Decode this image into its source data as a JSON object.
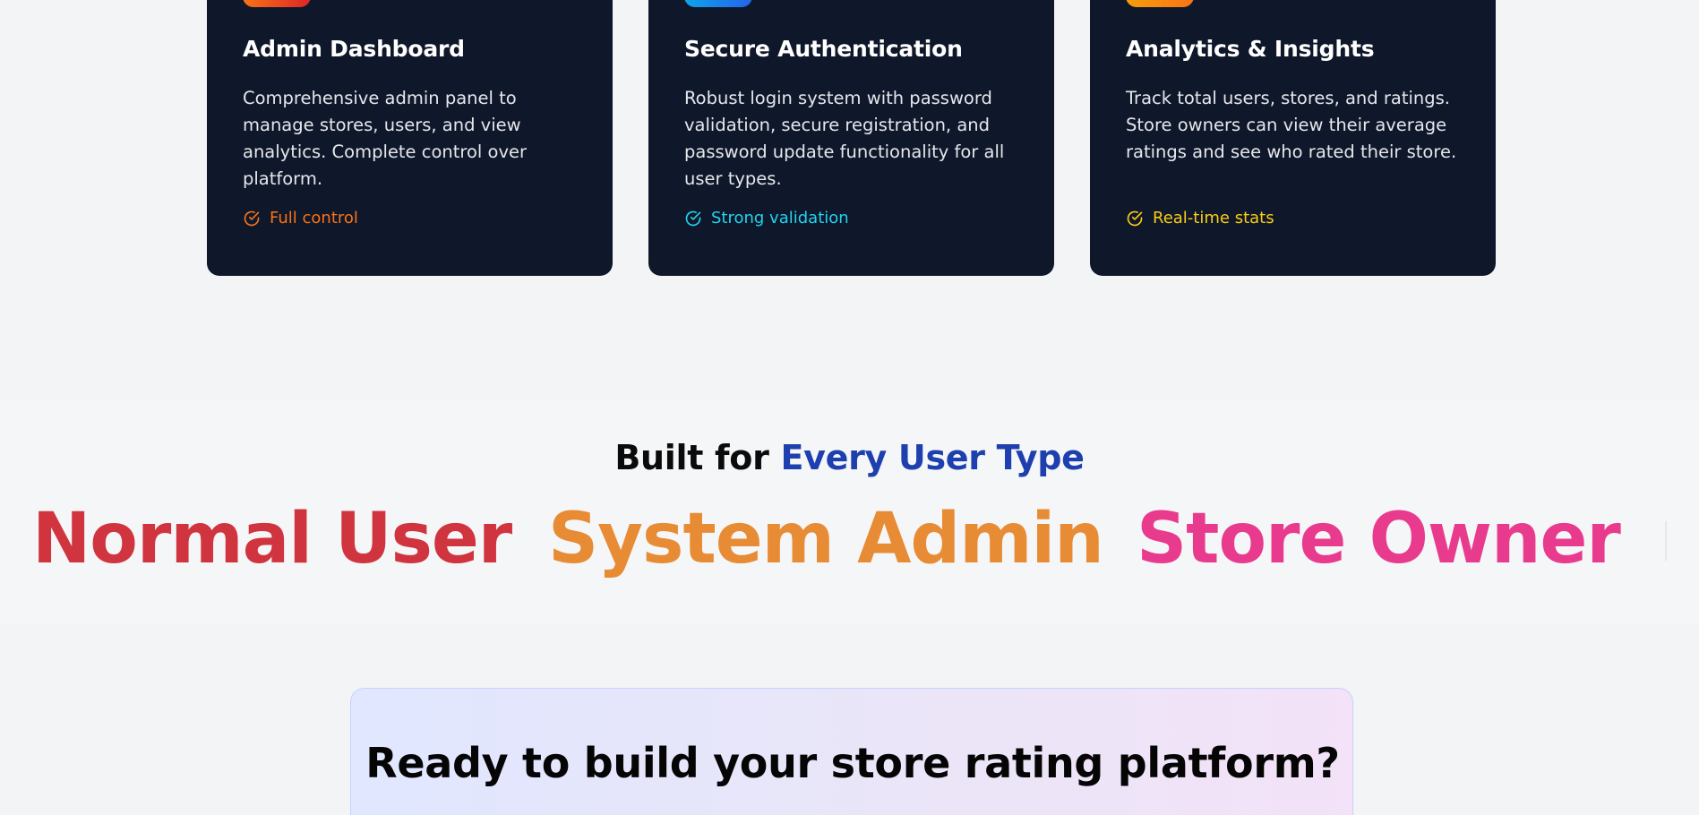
{
  "features": {
    "cards": [
      {
        "title": "Admin Dashboard",
        "description": "Comprehensive admin panel to manage stores, users, and view analytics. Complete control over platform.",
        "tag": "Full control",
        "accent": "#f97316",
        "badge_color": "#ea4a0c",
        "icon": "check-circle-icon"
      },
      {
        "title": "Secure Authentication",
        "description": "Robust login system with password validation, secure registration, and password update functionality for all user types.",
        "tag": "Strong validation",
        "accent": "#22d3ee",
        "badge_color": "#0ea5e9",
        "icon": "check-circle-icon"
      },
      {
        "title": "Analytics & Insights",
        "description": "Track total users, stores, and ratings. Store owners can view their average ratings and see who rated their store.",
        "tag": "Real-time stats",
        "accent": "#facc15",
        "badge_color": "#f59e0b",
        "icon": "check-circle-icon"
      }
    ]
  },
  "user_types": {
    "heading_prefix": "Built for",
    "heading_highlight": "Every User Type",
    "highlight_color": "#1e40af",
    "items": [
      {
        "label": "Normal User",
        "color": "#d0353f"
      },
      {
        "label": "System Admin",
        "color": "#e88b35"
      },
      {
        "label": "Store Owner",
        "color": "#e83b8d"
      }
    ]
  },
  "cta": {
    "title": "Ready to build your store rating platform?"
  }
}
